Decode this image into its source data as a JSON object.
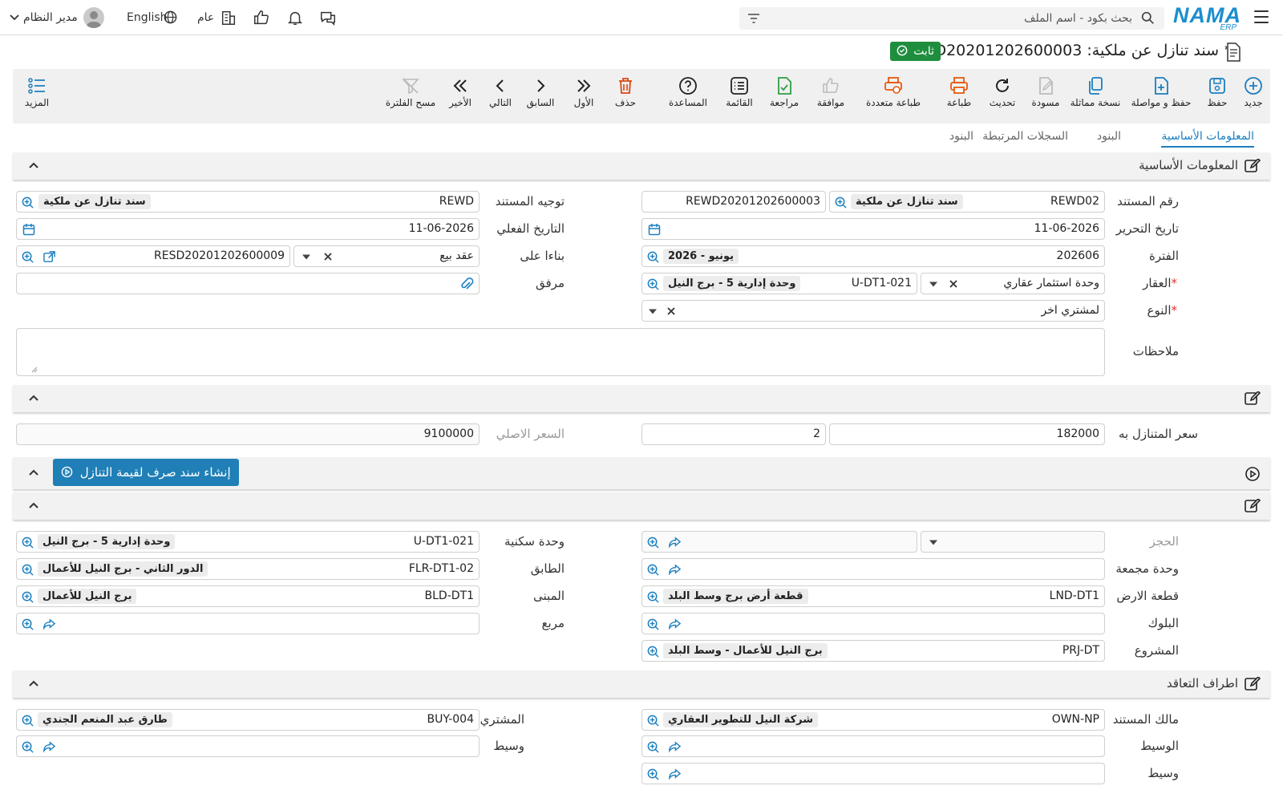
{
  "topbar": {
    "logo_main": "NAMA",
    "logo_sub": "ERP",
    "search_placeholder": "بحث بكود - اسم الملف",
    "user_name": "مدير النظام",
    "language": "English",
    "company": "عام"
  },
  "page": {
    "title": "سند تنازل عن ملكية: REWD20201202600003",
    "status_badge": "ثابت"
  },
  "toolbar": {
    "new": "جديد",
    "save": "حفظ",
    "save_continue": "حفظ و مواصلة",
    "duplicate": "نسخة مماثلة",
    "draft": "مسودة",
    "refresh": "تحديث",
    "print": "طباعة",
    "multi_print": "طباعة متعددة",
    "approve": "موافقة",
    "review": "مراجعة",
    "list": "القائمة",
    "help": "المساعدة",
    "delete": "حذف",
    "first": "الأول",
    "prev": "السابق",
    "next": "التالي",
    "last": "الأخير",
    "clear_filter": "مسح الفلترة",
    "more": "المزيد"
  },
  "tabs": [
    "المعلومات الأساسية",
    "البنود",
    "السجلات المرتبطة",
    "البنود"
  ],
  "section_basic": {
    "title": "المعلومات الأساسية",
    "doc_number_label": "رقم المستند",
    "doc_number_code": "REWD02",
    "doc_number_name": "سند تنازل عن ملكية",
    "doc_number_value": "REWD20201202600003",
    "direction_label": "توجيه المستند",
    "direction_code": "REWD",
    "direction_name": "سند تنازل عن ملكية",
    "edit_date_label": "تاريخ التحرير",
    "edit_date": "11-06-2026",
    "actual_date_label": "التاريخ الفعلي",
    "actual_date": "11-06-2026",
    "period_label": "الفترة",
    "period_code": "202606",
    "period_name": "2026 - يونيو",
    "based_on_label": "بناءا على",
    "based_on_type": "عقد بيع",
    "based_on_ref": "RESD20201202600009",
    "property_label": "العقار",
    "property_type": "وحدة استثمار عقاري",
    "property_code": "U-DT1-021",
    "property_name": "وحدة إدارية 5 - برج النيل",
    "attachment_label": "مرفق",
    "kind_label": "النوع",
    "kind_value": "لمشتري اخر",
    "notes_label": "ملاحظات"
  },
  "section_price": {
    "title": "",
    "waived_price_label": "سعر المتنازل به",
    "waived_price": "182000",
    "waived_qty": "2",
    "original_price_label": "السعر الاصلي",
    "original_price": "9100000"
  },
  "section_action": {
    "button": "إنشاء سند صرف لقيمة التنازل"
  },
  "section_location": {
    "title": "",
    "reservation_label": "الحجز",
    "residential_unit_label": "وحدة سكنية",
    "residential_unit_code": "U-DT1-021",
    "residential_unit_name": "وحدة إدارية 5 - برج النيل",
    "group_unit_label": "وحدة مجمعة",
    "floor_label": "الطابق",
    "floor_code": "FLR-DT1-02",
    "floor_name": "الدور الثاني - برج النيل للأعمال",
    "land_label": "قطعة الارض",
    "land_code": "LND-DT1",
    "land_name": "قطعة أرض برج وسط البلد",
    "building_label": "المبنى",
    "building_code": "BLD-DT1",
    "building_name": "برج النيل للأعمال",
    "block_label": "البلوك",
    "square_label": "مربع",
    "project_label": "المشروع",
    "project_code": "PRJ-DT",
    "project_name": "برج النيل للأعمال - وسط البلد"
  },
  "section_parties": {
    "title": "اطراف التعاقد",
    "owner_label": "مالك المستند",
    "owner_code": "OWN-NP",
    "owner_name": "شركة النيل للتطوير العقاري",
    "buyer_label": "المشتري",
    "buyer_code": "BUY-004",
    "buyer_name": "طارق عبد المنعم الجندي",
    "broker_label": "الوسيط",
    "broker2_label": "وسيط",
    "broker3_label": "وسيط"
  },
  "colors": {
    "accent": "#1b7fbf",
    "badge": "#1e8e3e",
    "orange": "#e8590c",
    "green": "#2f9e44"
  }
}
